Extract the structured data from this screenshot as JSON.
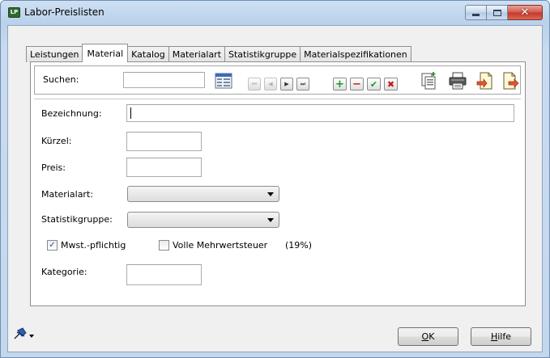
{
  "window": {
    "title": "Labor-Preislisten",
    "icon": "app-logo-icon",
    "icon_text": "LP"
  },
  "tabs": [
    {
      "label": "Leistungen",
      "active": false
    },
    {
      "label": "Material",
      "active": true
    },
    {
      "label": "Katalog",
      "active": false
    },
    {
      "label": "Materialart",
      "active": false
    },
    {
      "label": "Statistikgruppe",
      "active": false
    },
    {
      "label": "Materialspezifikationen",
      "active": false
    }
  ],
  "search": {
    "label": "Suchen:",
    "value": ""
  },
  "toolbar": {
    "nav": [
      "first-record-icon",
      "previous-record-icon",
      "next-record-icon",
      "last-record-icon"
    ],
    "nav_glyphs": [
      "⏮",
      "◀",
      "▶",
      "⏭"
    ],
    "actions": [
      "add-icon",
      "remove-icon",
      "confirm-icon",
      "cancel-icon"
    ],
    "action_glyphs": [
      "+",
      "−",
      "✔",
      "✖"
    ],
    "tools": [
      "copy-document-icon",
      "print-icon",
      "import-icon",
      "export-icon"
    ]
  },
  "form": {
    "bezeichnung": {
      "label": "Bezeichnung:",
      "value": ""
    },
    "kuerzel": {
      "label": "Kürzel:",
      "value": ""
    },
    "preis": {
      "label": "Preis:",
      "value": ""
    },
    "materialart": {
      "label": "Materialart:",
      "value": ""
    },
    "statistikgruppe": {
      "label": "Statistikgruppe:",
      "value": ""
    },
    "mwst": {
      "label": "Mwst.-pflichtig",
      "checked": true
    },
    "volle_mwst": {
      "label": "Volle Mehrwertsteuer",
      "checked": false
    },
    "mwst_rate": "(19%)",
    "kategorie": {
      "label": "Kategorie:",
      "value": ""
    }
  },
  "footer": {
    "ok": {
      "pre": "",
      "accel": "O",
      "post": "K"
    },
    "help": {
      "pre": "",
      "accel": "H",
      "post": "ilfe"
    }
  },
  "colors": {
    "add": "#1a9a1a",
    "remove": "#cc1f1f",
    "confirm": "#1f9f1f",
    "cancel": "#c41a1a"
  }
}
